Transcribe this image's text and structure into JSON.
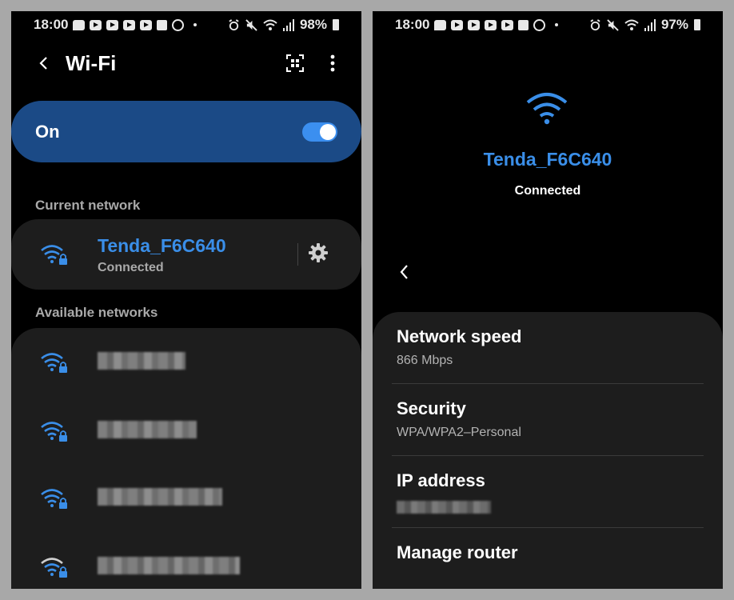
{
  "left_screen": {
    "status_bar": {
      "time": "18:00",
      "battery": "98%"
    },
    "header": {
      "title": "Wi-Fi",
      "back_icon": "back-arrow-icon",
      "qr_icon": "qr-scan-icon",
      "more_icon": "more-vert-icon"
    },
    "toggle": {
      "label": "On",
      "state": "on"
    },
    "current_network": {
      "section_label": "Current network",
      "name": "Tenda_F6C640",
      "status": "Connected",
      "settings_icon": "gear-icon"
    },
    "available": {
      "section_label": "Available networks",
      "networks": [
        {
          "name_redacted": true,
          "signal": "full"
        },
        {
          "name_redacted": true,
          "signal": "full"
        },
        {
          "name_redacted": true,
          "signal": "full"
        },
        {
          "name_redacted": true,
          "signal": "weak"
        }
      ]
    }
  },
  "right_screen": {
    "status_bar": {
      "time": "18:00",
      "battery": "97%"
    },
    "network": {
      "name": "Tenda_F6C640",
      "status": "Connected"
    },
    "details": {
      "speed_label": "Network speed",
      "speed_value": "866 Mbps",
      "security_label": "Security",
      "security_value": "WPA/WPA2–Personal",
      "ip_label": "IP address",
      "router_label": "Manage router"
    }
  },
  "colors": {
    "accent": "#3a8ee8",
    "toggle_card": "#1b4a86",
    "card_bg": "#1d1d1d",
    "background": "#000000"
  }
}
